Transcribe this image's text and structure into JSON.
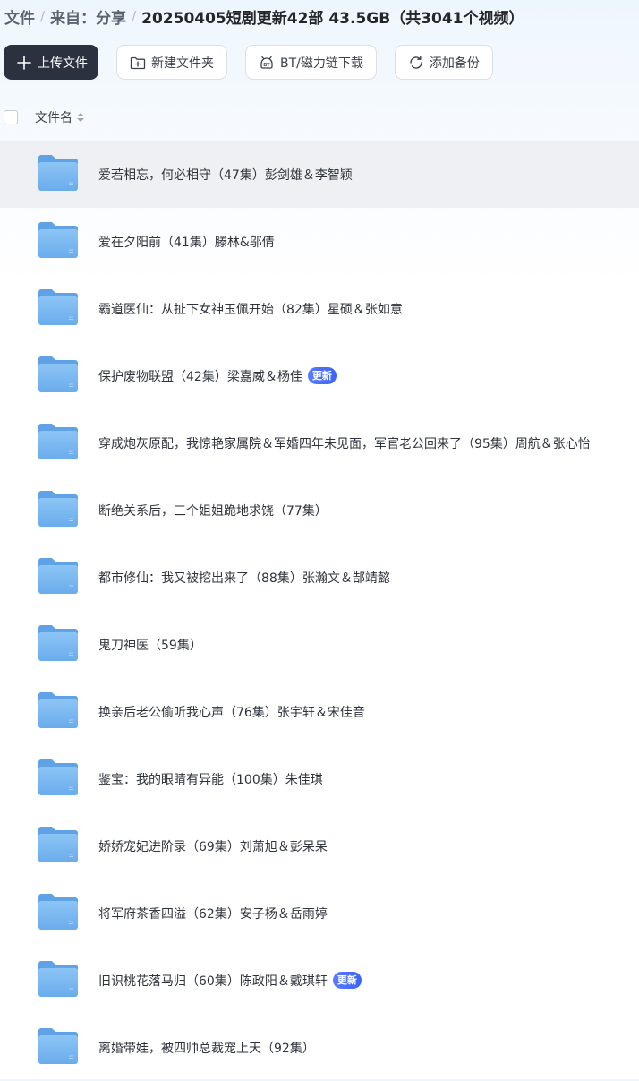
{
  "breadcrumb": {
    "items": [
      "文件",
      "来自：分享"
    ],
    "current": "20250405短剧更新42部 43.5GB（共3041个视频）",
    "separator": "/"
  },
  "toolbar": {
    "upload": {
      "label": "上传文件",
      "icon": "plus-icon"
    },
    "new_folder": {
      "label": "新建文件夹",
      "icon": "new-folder-icon"
    },
    "bt": {
      "label": "BT/磁力链下载",
      "icon": "bt-icon"
    },
    "backup": {
      "label": "添加备份",
      "icon": "sync-icon"
    }
  },
  "list_header": {
    "column_name": "文件名"
  },
  "files": [
    {
      "name": "爱若相忘，何必相守（47集）彭剑雄＆李智颖",
      "badge": ""
    },
    {
      "name": "爱在夕阳前（41集）滕林&邬倩",
      "badge": ""
    },
    {
      "name": "霸道医仙：从扯下女神玉佩开始（82集）星硕＆张如意",
      "badge": ""
    },
    {
      "name": "保护废物联盟（42集）梁嘉威＆杨佳",
      "badge": "更新"
    },
    {
      "name": "穿成炮灰原配，我惊艳家属院＆军婚四年未见面，军官老公回来了（95集）周航＆张心怡",
      "badge": ""
    },
    {
      "name": "断绝关系后，三个姐姐跪地求饶（77集）",
      "badge": ""
    },
    {
      "name": "都市修仙：我又被挖出来了（88集）张瀚文＆郜靖懿",
      "badge": ""
    },
    {
      "name": "鬼刀神医（59集）",
      "badge": ""
    },
    {
      "name": "换亲后老公偷听我心声（76集）张宇轩＆宋佳音",
      "badge": ""
    },
    {
      "name": "鉴宝：我的眼睛有异能（100集）朱佳琪",
      "badge": ""
    },
    {
      "name": "娇娇宠妃进阶录（69集）刘萧旭＆彭呆呆",
      "badge": ""
    },
    {
      "name": "将军府茶香四溢（62集）安子杨＆岳雨婷",
      "badge": ""
    },
    {
      "name": "旧识桃花落马归（60集）陈政阳＆戴琪轩",
      "badge": "更新"
    },
    {
      "name": "离婚带娃，被四帅总裁宠上天（92集）",
      "badge": ""
    }
  ],
  "colors": {
    "primary_button": "#2c3140",
    "badge": "#3d63f6",
    "folder": "#78b6f0"
  }
}
